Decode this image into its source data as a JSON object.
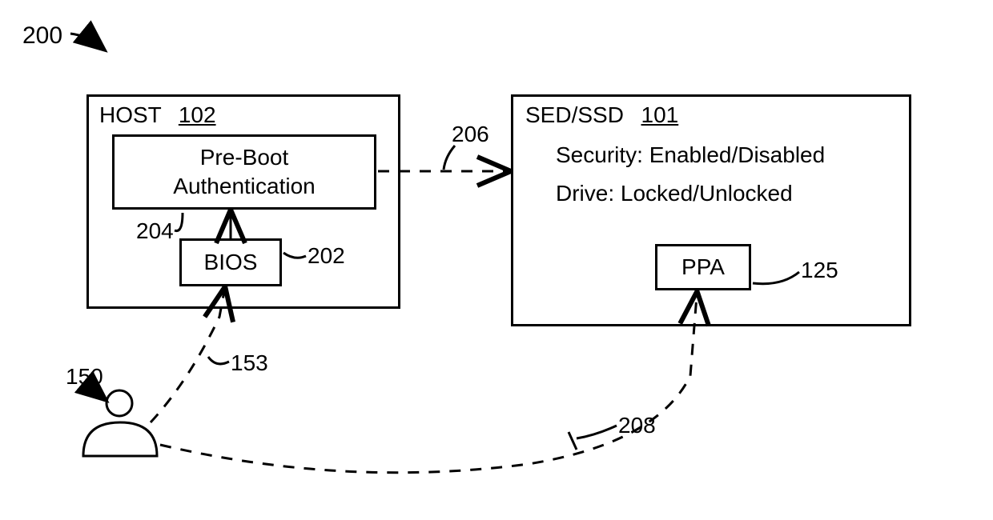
{
  "figure_number": "200",
  "host": {
    "title_prefix": "HOST",
    "ref": "102",
    "preboot": {
      "line1": "Pre-Boot",
      "line2": "Authentication",
      "ref": "204"
    },
    "bios": {
      "label": "BIOS",
      "ref": "202"
    }
  },
  "drive": {
    "title_prefix": "SED/SSD",
    "ref": "101",
    "security_line": "Security: Enabled/Disabled",
    "drive_line": "Drive: Locked/Unlocked",
    "ppa": {
      "label": "PPA",
      "ref": "125"
    }
  },
  "connections": {
    "host_to_drive_ref": "206",
    "user_to_bios_ref": "153",
    "user_to_ppa_ref": "208"
  },
  "user": {
    "ref": "150"
  }
}
